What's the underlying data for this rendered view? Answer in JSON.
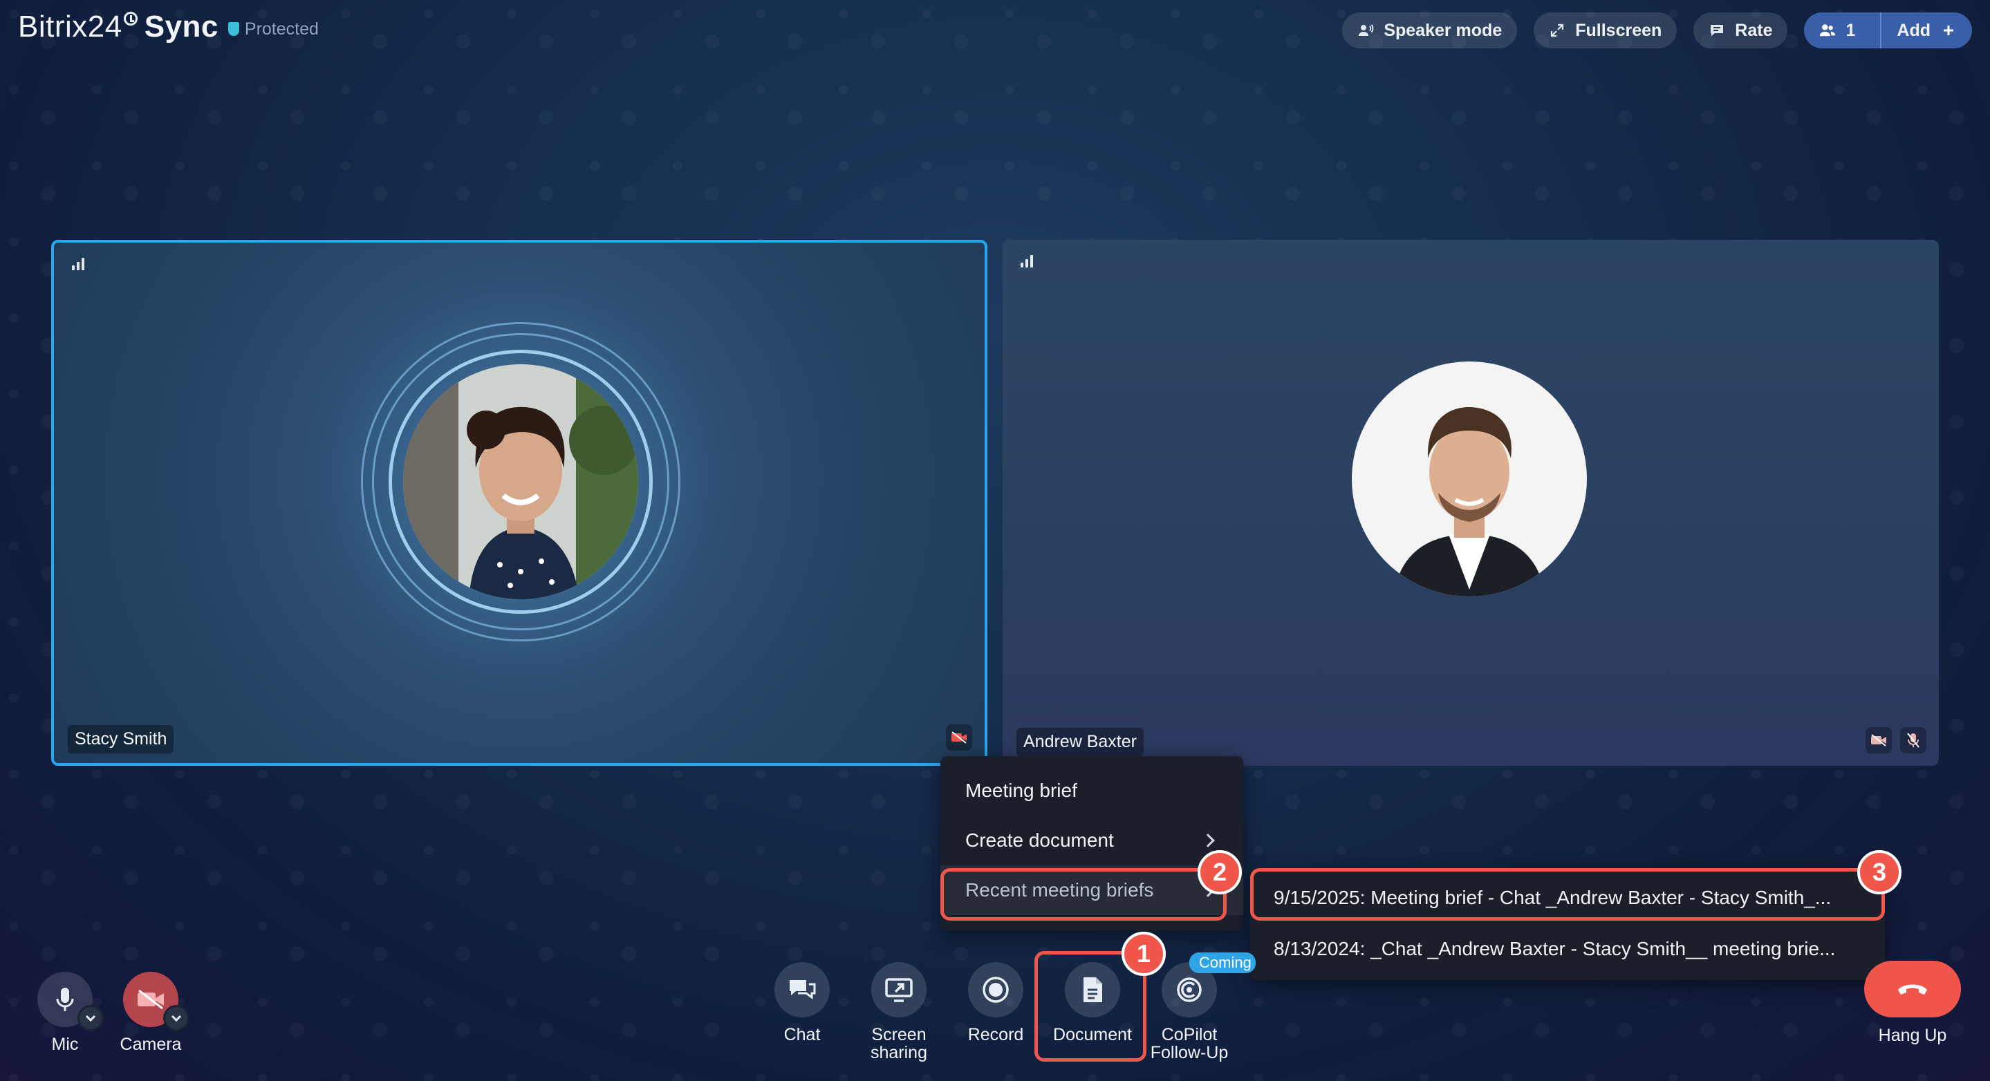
{
  "header": {
    "brand_regular": "Bitrix24",
    "brand_bold": "Sync",
    "protected_label": "Protected",
    "buttons": {
      "speaker_mode": "Speaker mode",
      "fullscreen": "Fullscreen",
      "rate": "Rate",
      "participants_count": "1",
      "add": "Add"
    }
  },
  "tiles": [
    {
      "name": "Stacy Smith",
      "speaking": true,
      "camera_off": true,
      "mic_off": false
    },
    {
      "name": "Andrew Baxter",
      "speaking": false,
      "camera_off": true,
      "mic_off": true
    }
  ],
  "document_menu": {
    "items": [
      {
        "label": "Meeting brief",
        "has_submenu": false
      },
      {
        "label": "Create document",
        "has_submenu": true
      },
      {
        "label": "Recent meeting briefs",
        "has_submenu": true
      }
    ]
  },
  "recent_briefs": [
    "9/15/2025: Meeting brief - Chat _Andrew Baxter - Stacy Smith_...",
    "8/13/2024: _Chat _Andrew Baxter - Stacy Smith__ meeting brie..."
  ],
  "annotations": {
    "step1": "1",
    "step2": "2",
    "step3": "3"
  },
  "toolbar": {
    "mic": "Mic",
    "camera": "Camera",
    "chat": "Chat",
    "screen_sharing_1": "Screen",
    "screen_sharing_2": "sharing",
    "record": "Record",
    "document": "Document",
    "copilot_1": "CoPilot",
    "copilot_2": "Follow-Up",
    "coming_badge": "Coming",
    "hang_up": "Hang Up"
  },
  "colors": {
    "accent_blue": "#2aa6ee",
    "annotation_red": "#f0564a",
    "menu_bg": "#1b1f2a",
    "add_button": "#3a5fa8",
    "coming_badge": "#2fa5e8"
  }
}
